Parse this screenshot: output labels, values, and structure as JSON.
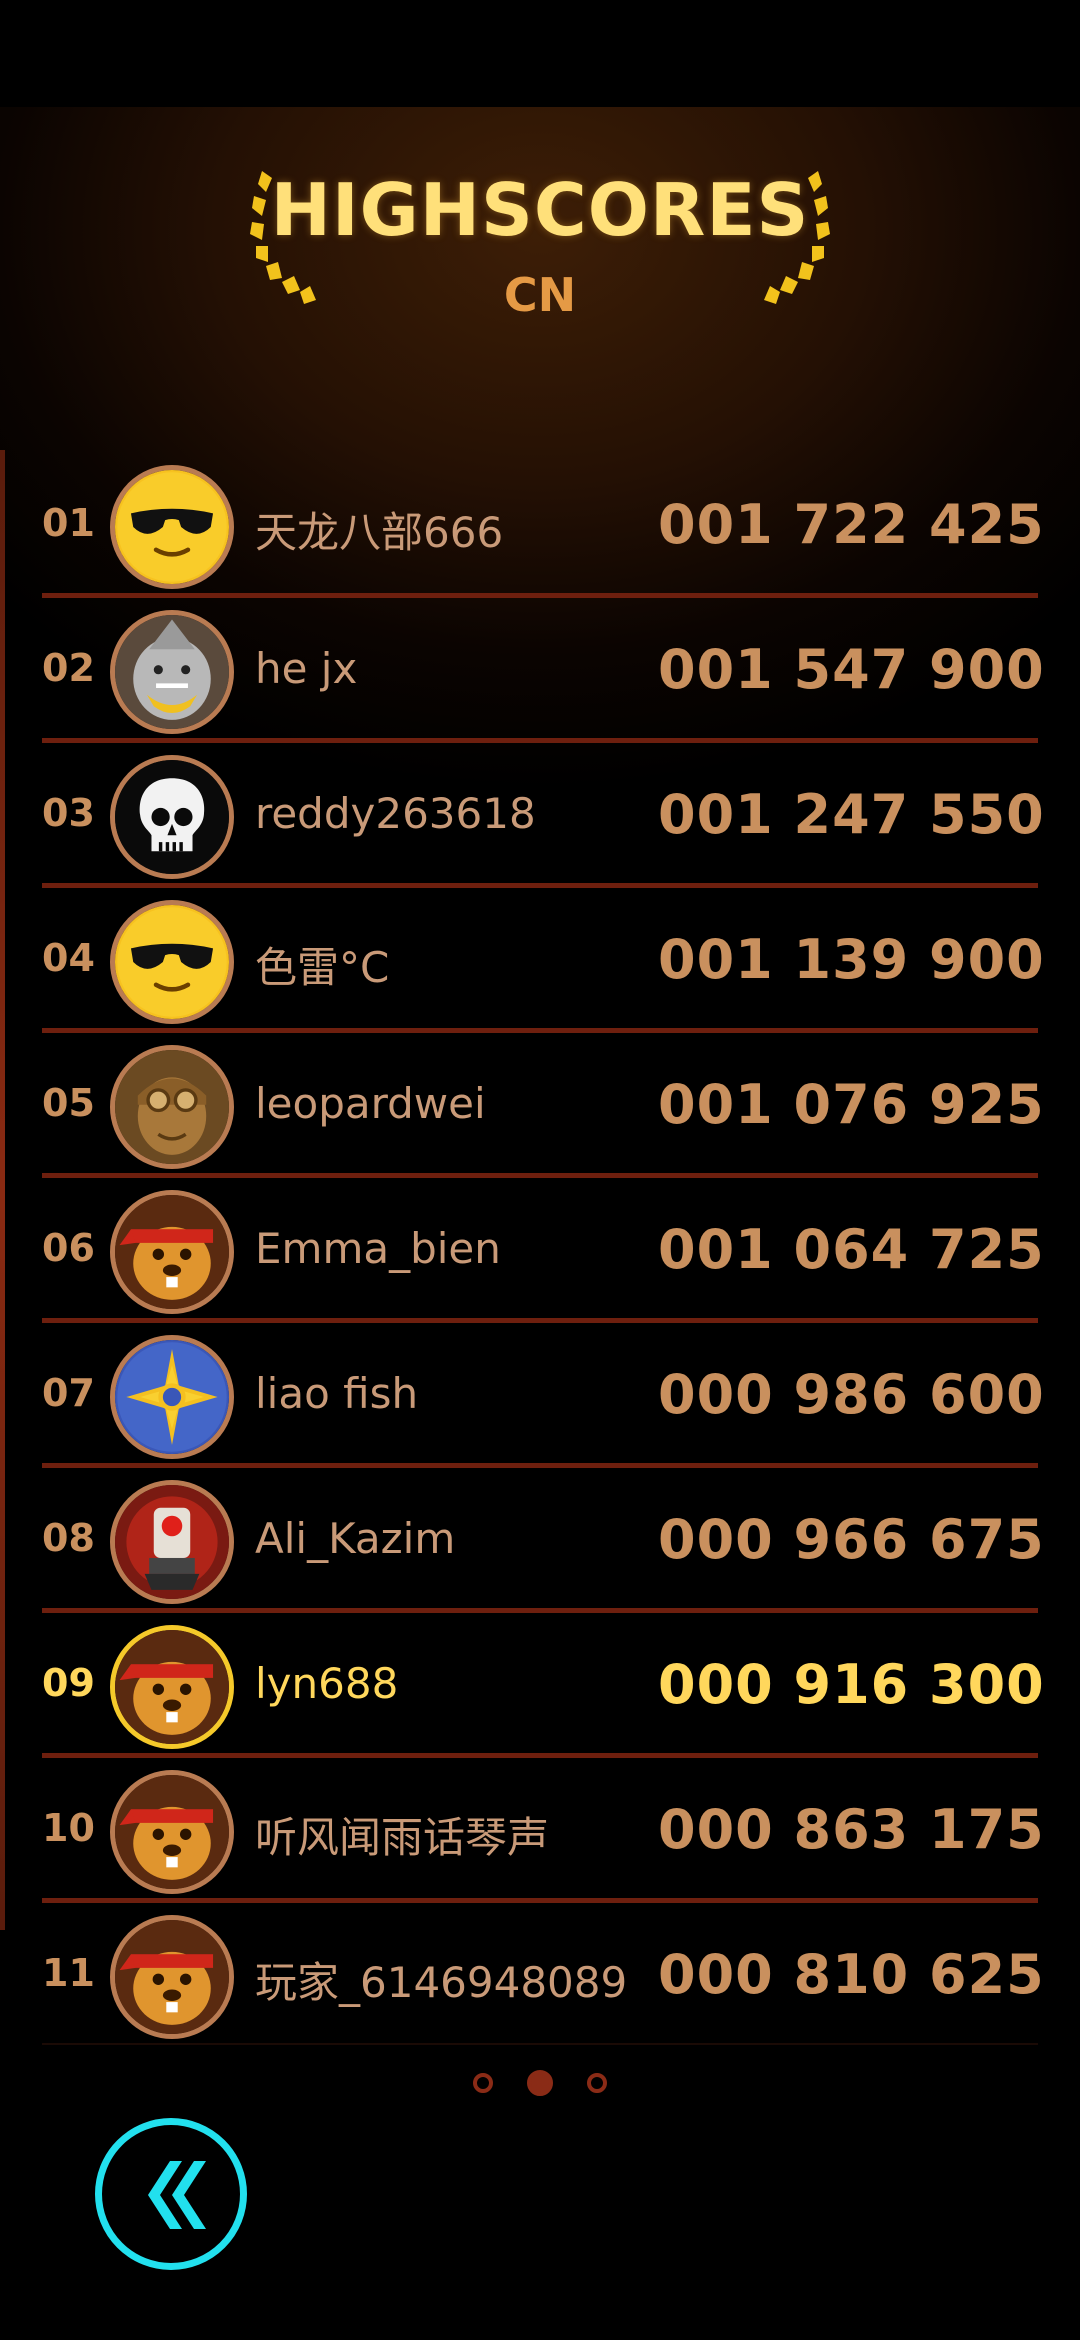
{
  "header": {
    "title": "HIGHSCORES",
    "region": "CN",
    "title_color": "#ffe07a",
    "region_color": "#e59a45"
  },
  "leaderboard": [
    {
      "rank": "01",
      "name": "天龙八部666",
      "score": "001 722 425",
      "avatar": "sunglasses-emoji"
    },
    {
      "rank": "02",
      "name": "he jx",
      "score": "001 547 900",
      "avatar": "shark"
    },
    {
      "rank": "03",
      "name": "reddy263618",
      "score": "001 247 550",
      "avatar": "skull"
    },
    {
      "rank": "04",
      "name": "色雷°C",
      "score": "001 139 900",
      "avatar": "sunglasses-emoji"
    },
    {
      "rank": "05",
      "name": "leopardwei",
      "score": "001 076 925",
      "avatar": "pilot"
    },
    {
      "rank": "06",
      "name": "Emma_bien",
      "score": "001 064 725",
      "avatar": "beaver-bandana"
    },
    {
      "rank": "07",
      "name": "liao fish",
      "score": "000 986 600",
      "avatar": "star-compass"
    },
    {
      "rank": "08",
      "name": "Ali_Kazim",
      "score": "000 966 675",
      "avatar": "robot"
    },
    {
      "rank": "09",
      "name": "lyn688",
      "score": "000 916 300",
      "avatar": "beaver-bandana",
      "highlight": true
    },
    {
      "rank": "10",
      "name": "听风闻雨话琴声",
      "score": "000 863 175",
      "avatar": "beaver-bandana"
    },
    {
      "rank": "11",
      "name": "玩家_6146948089",
      "score": "000 810 625",
      "avatar": "beaver-bandana"
    }
  ],
  "pager": {
    "pages": 3,
    "current_page": 2
  },
  "back_button": {
    "icon": "double-chevron-left-icon",
    "color": "#22e0ee"
  },
  "colors": {
    "row_text": "#c9905e",
    "highlight_text": "#ffd75c",
    "divider": "#6e1f0e",
    "avatar_border": "#b97b52"
  }
}
